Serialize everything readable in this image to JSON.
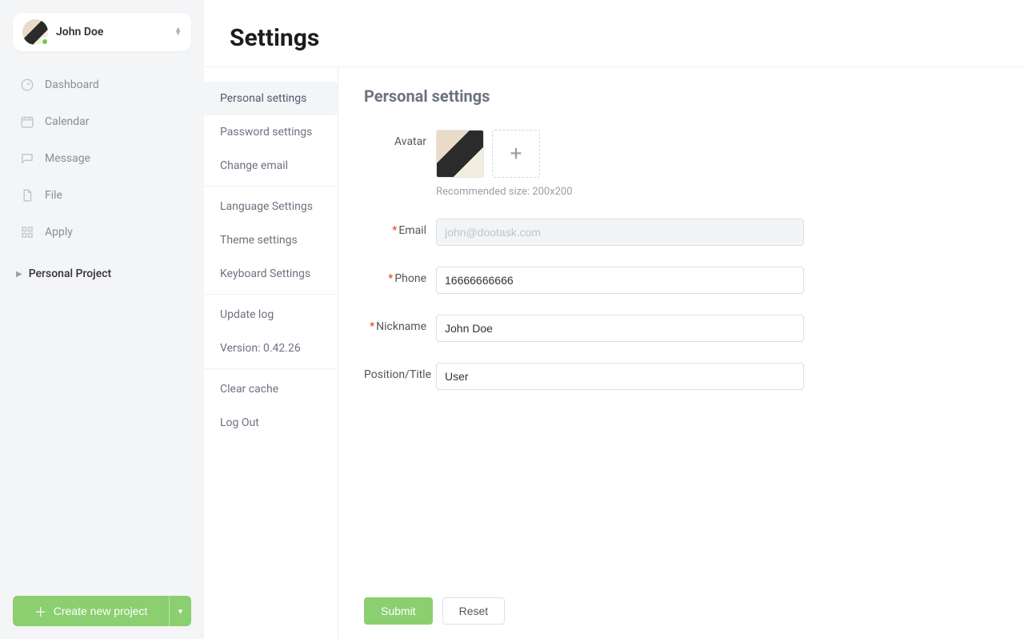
{
  "user": {
    "name": "John Doe"
  },
  "sidebar": {
    "nav": [
      {
        "label": "Dashboard"
      },
      {
        "label": "Calendar"
      },
      {
        "label": "Message"
      },
      {
        "label": "File"
      },
      {
        "label": "Apply"
      }
    ],
    "section": {
      "title": "Personal Project"
    },
    "create_label": "Create new project"
  },
  "page": {
    "title": "Settings"
  },
  "settings_nav": {
    "groups": [
      [
        {
          "label": "Personal settings",
          "active": true
        },
        {
          "label": "Password settings"
        },
        {
          "label": "Change email"
        }
      ],
      [
        {
          "label": "Language Settings"
        },
        {
          "label": "Theme settings"
        },
        {
          "label": "Keyboard Settings"
        }
      ],
      [
        {
          "label": "Update log"
        },
        {
          "label": "Version: 0.42.26",
          "static": true
        }
      ],
      [
        {
          "label": "Clear cache"
        },
        {
          "label": "Log Out"
        }
      ]
    ]
  },
  "panel": {
    "title": "Personal settings",
    "avatar": {
      "label": "Avatar",
      "hint": "Recommended size: 200x200",
      "add_glyph": "+"
    },
    "fields": {
      "email": {
        "label": "Email",
        "required": true,
        "placeholder": "john@dootask.com",
        "value": "",
        "disabled": true
      },
      "phone": {
        "label": "Phone",
        "required": true,
        "placeholder": "",
        "value": "16666666666",
        "disabled": false
      },
      "nickname": {
        "label": "Nickname",
        "required": true,
        "placeholder": "",
        "value": "John Doe",
        "disabled": false
      },
      "position": {
        "label": "Position/Title",
        "required": false,
        "placeholder": "",
        "value": "User",
        "disabled": false
      }
    },
    "buttons": {
      "submit": "Submit",
      "reset": "Reset"
    }
  }
}
